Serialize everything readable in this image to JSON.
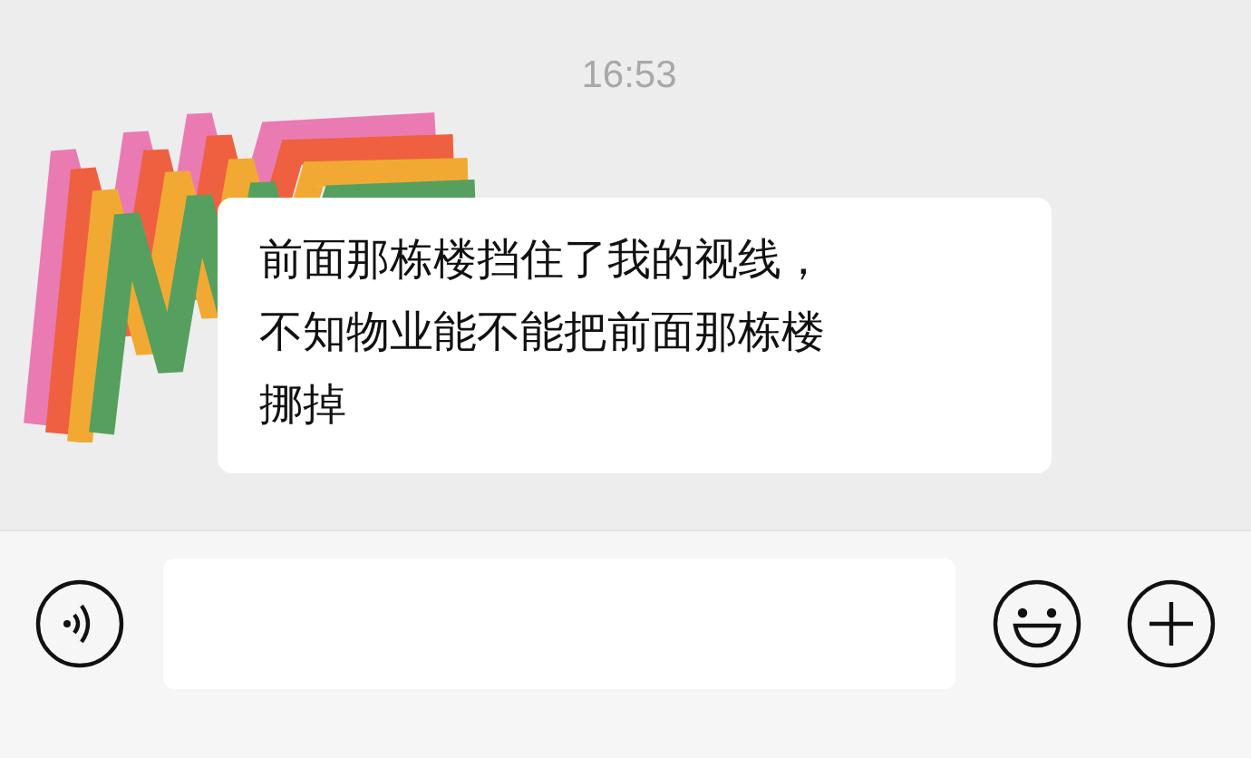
{
  "timestamp": "16:53",
  "messages": [
    {
      "kind": "received",
      "text": "前面那栋楼挡住了我的视线，不知物业能不能把前面那栋楼挪掉"
    }
  ]
}
